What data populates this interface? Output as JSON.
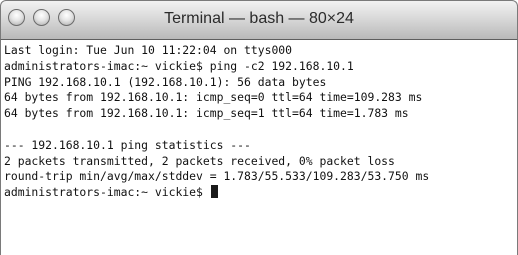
{
  "window": {
    "title": "Terminal — bash — 80×24"
  },
  "terminal": {
    "lines": [
      "Last login: Tue Jun 10 11:22:04 on ttys000",
      "administrators-imac:~ vickie$ ping -c2 192.168.10.1",
      "PING 192.168.10.1 (192.168.10.1): 56 data bytes",
      "64 bytes from 192.168.10.1: icmp_seq=0 ttl=64 time=109.283 ms",
      "64 bytes from 192.168.10.1: icmp_seq=1 ttl=64 time=1.783 ms",
      "",
      "--- 192.168.10.1 ping statistics ---",
      "2 packets transmitted, 2 packets received, 0% packet loss",
      "round-trip min/avg/max/stddev = 1.783/55.533/109.283/53.750 ms"
    ],
    "prompt": "administrators-imac:~ vickie$ "
  },
  "icons": {
    "close": "close-button-icon",
    "minimize": "minimize-button-icon",
    "zoom": "zoom-button-icon"
  }
}
